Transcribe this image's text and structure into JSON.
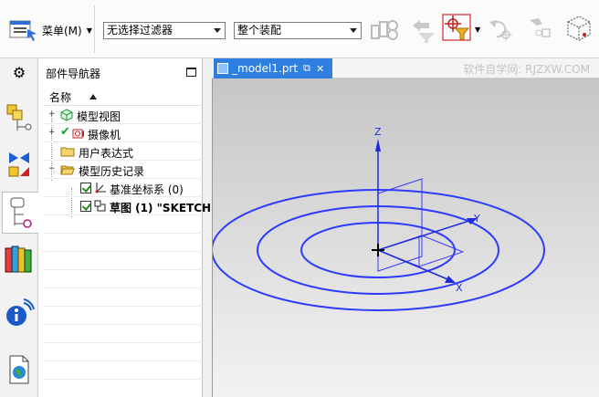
{
  "toolbar": {
    "menu_label": "菜单(M)",
    "filter_select": "无选择过滤器",
    "assembly_select": "整个装配"
  },
  "navigator": {
    "title": "部件导航器",
    "column_name": "名称",
    "items": [
      {
        "label": "模型视图"
      },
      {
        "label": "摄像机"
      },
      {
        "label": "用户表达式"
      },
      {
        "label": "模型历史记录"
      },
      {
        "label": "基准坐标系 (0)"
      },
      {
        "label": "草图 (1) \"SKETCH"
      }
    ]
  },
  "viewport": {
    "tab_label": "_model1.prt",
    "watermark": "软件自学网: RJZXW.COM",
    "axis_z": "Z",
    "axis_y": "Y",
    "axis_x": "X"
  },
  "colors": {
    "accent": "#2f7fe0",
    "sketch_blue": "#2c3cff"
  }
}
